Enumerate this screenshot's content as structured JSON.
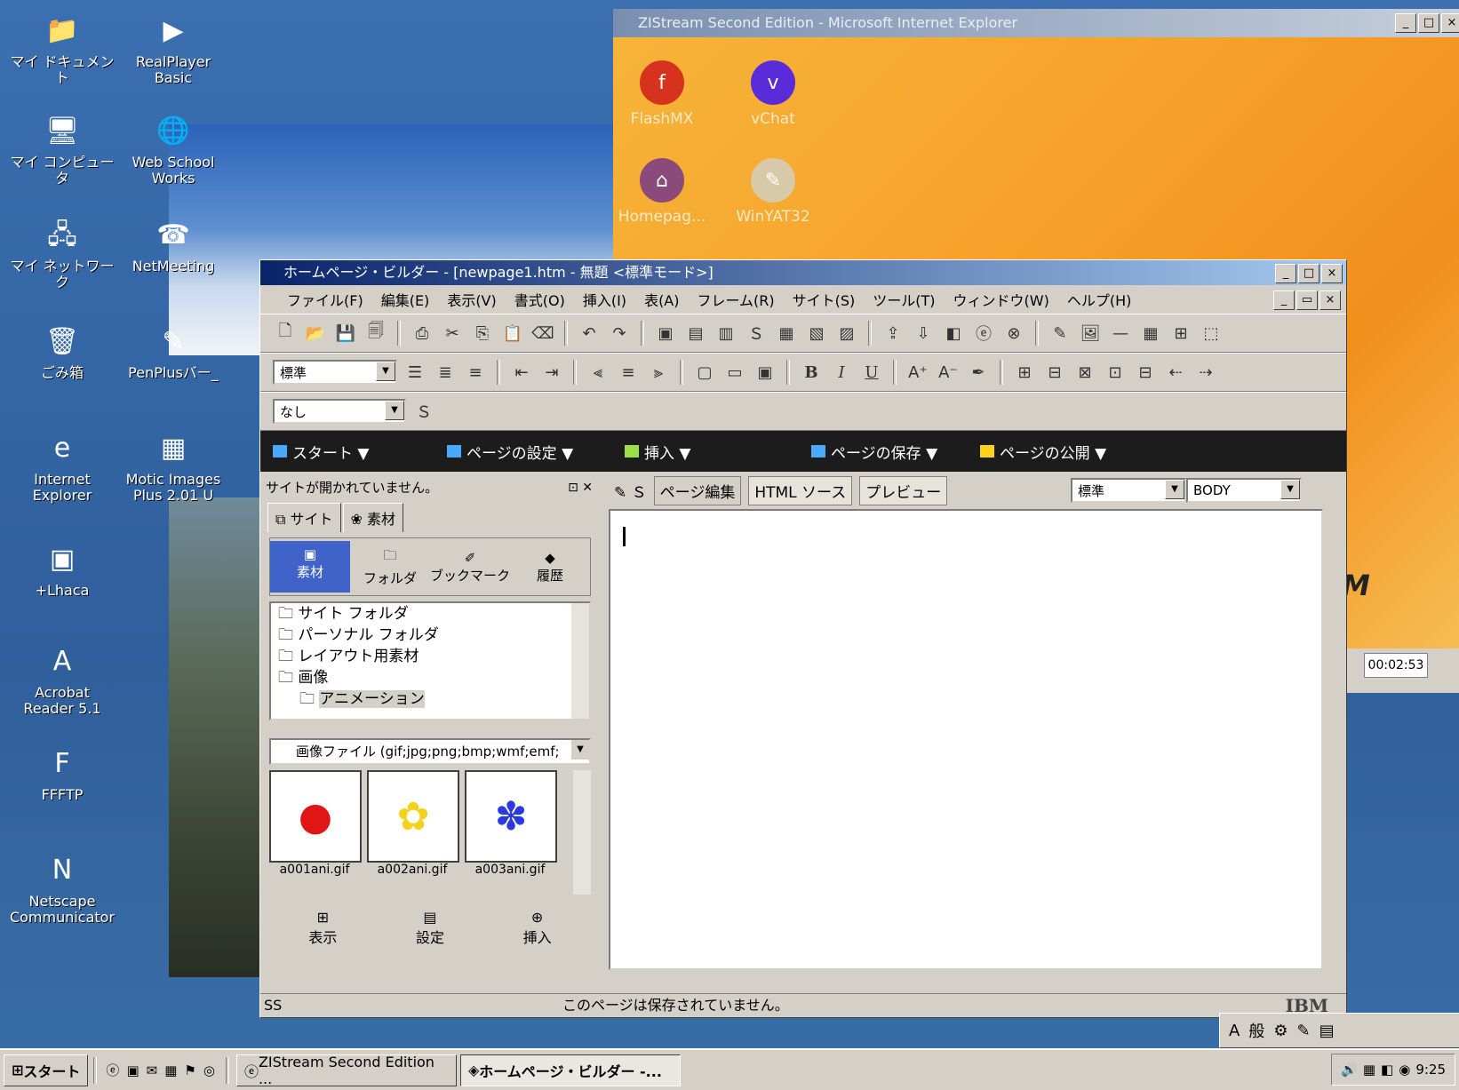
{
  "desktop": {
    "icons": [
      {
        "label": "マイ ドキュメント",
        "icon": "folder-icon",
        "glyph": "📁"
      },
      {
        "label": "RealPlayer Basic",
        "icon": "realplayer-icon",
        "glyph": "▶"
      },
      {
        "label": "マイ コンピュータ",
        "icon": "computer-icon",
        "glyph": "🖥"
      },
      {
        "label": "Web School Works",
        "icon": "webschool-icon",
        "glyph": "🌐"
      },
      {
        "label": "マイ ネットワーク",
        "icon": "network-icon",
        "glyph": "🖧"
      },
      {
        "label": "NetMeeting",
        "icon": "netmeeting-icon",
        "glyph": "☎"
      },
      {
        "label": "ごみ箱",
        "icon": "recycle-bin-icon",
        "glyph": "🗑"
      },
      {
        "label": "PenPlusバー_",
        "icon": "penplus-icon",
        "glyph": "✎"
      },
      {
        "label": "Internet Explorer",
        "icon": "ie-icon",
        "glyph": "e"
      },
      {
        "label": "Motic Images Plus 2.01 U",
        "icon": "motic-icon",
        "glyph": "▦"
      },
      {
        "label": "+Lhaca",
        "icon": "lhaca-icon",
        "glyph": "▣"
      },
      {
        "label": "Acrobat Reader 5.1",
        "icon": "acrobat-icon",
        "glyph": "A"
      },
      {
        "label": "FFFTP",
        "icon": "ffftp-icon",
        "glyph": "F"
      },
      {
        "label": "Netscape Communicator",
        "icon": "netscape-icon",
        "glyph": "N"
      }
    ]
  },
  "ie": {
    "title": "ZIStream Second Edition - Microsoft Internet Explorer",
    "icons": [
      {
        "label": "FlashMX",
        "color": "#d6321e",
        "glyph": "f"
      },
      {
        "label": "vChat",
        "color": "#5a2bd8",
        "glyph": "v"
      },
      {
        "label": "Homepag...",
        "color": "#8a4a7a",
        "glyph": "⌂"
      },
      {
        "label": "WinYAT32",
        "color": "#d8c9a8",
        "glyph": "✎"
      }
    ],
    "time": "00:02:53",
    "watermark": "M"
  },
  "builder": {
    "title": "ホームページ・ビルダー - [newpage1.htm - 無題 <標準モード>]",
    "menu": [
      "ファイル(F)",
      "編集(E)",
      "表示(V)",
      "書式(O)",
      "挿入(I)",
      "表(A)",
      "フレーム(R)",
      "サイト(S)",
      "ツール(T)",
      "ウィンドウ(W)",
      "ヘルプ(H)"
    ],
    "style_combo": "標準",
    "font_combo": "なし",
    "bold": "B",
    "italic": "I",
    "underline": "U",
    "taskbar_items": [
      "スタート ▼",
      "ページの設定 ▼",
      "挿入 ▼",
      "ページの保存 ▼",
      "ページの公開 ▼"
    ],
    "left_panel": {
      "title": "サイトが開かれていません。",
      "tabs": [
        "サイト",
        "素材"
      ],
      "buttons": [
        "素材",
        "フォルダ",
        "ブックマーク",
        "履歴"
      ],
      "tree": [
        "サイト フォルダ",
        "パーソナル フォルダ",
        "レイアウト用素材",
        "画像",
        "アニメーション"
      ],
      "filter": "画像ファイル (gif;jpg;png;bmp;wmf;emf;",
      "thumbs": [
        {
          "name": "a001ani.gif",
          "color": "#e01515",
          "glyph": "●"
        },
        {
          "name": "a002ani.gif",
          "color": "#f2d21a",
          "glyph": "✿"
        },
        {
          "name": "a003ani.gif",
          "color": "#2a3ae0",
          "glyph": "✽"
        }
      ],
      "bottom_buttons": [
        "表示",
        "設定",
        "挿入"
      ]
    },
    "editor": {
      "tabs": [
        "ページ編集",
        "HTML ソース",
        "プレビュー"
      ],
      "mode": "標準",
      "tag": "BODY"
    },
    "status": {
      "left": "SS",
      "message": "このページは保存されていません。",
      "brand": "IBM"
    }
  },
  "taskbar": {
    "start": "スタート",
    "tasks": [
      "ZIStream Second Edition ...",
      "ホームページ・ビルダー -..."
    ],
    "clock": "9:25"
  },
  "ime": {
    "items": [
      "A",
      "般"
    ]
  }
}
